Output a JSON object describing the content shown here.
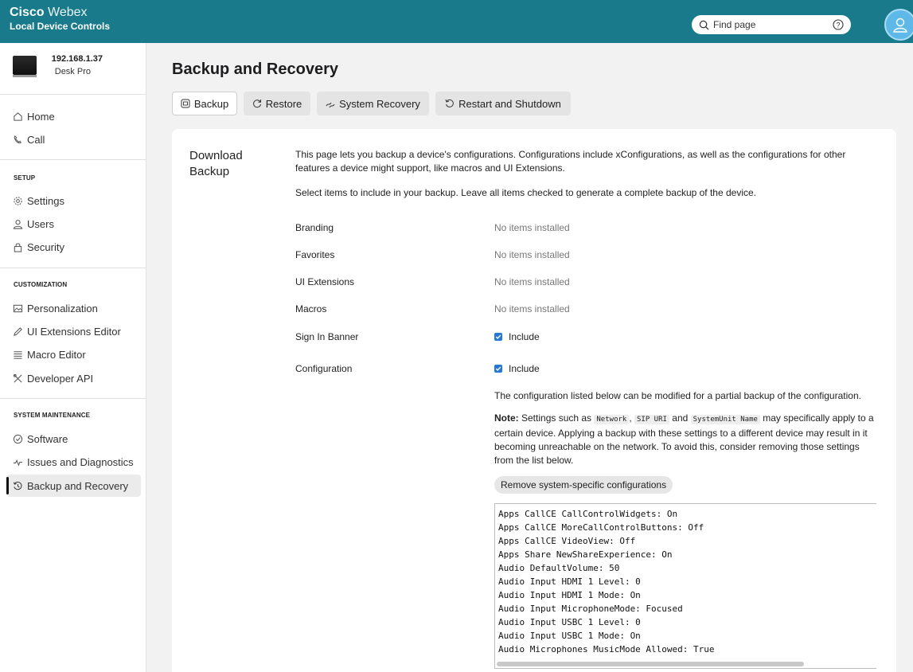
{
  "header": {
    "brand_cisco": "Cisco",
    "brand_webex": "Webex",
    "subtitle": "Local Device Controls",
    "search_placeholder": "Find page"
  },
  "sidebar": {
    "device_ip": "192.168.1.37",
    "device_model": "Desk Pro",
    "items_top": [
      {
        "label": "Home",
        "icon": "home-icon"
      },
      {
        "label": "Call",
        "icon": "phone-icon"
      }
    ],
    "setup_heading": "SETUP",
    "setup_items": [
      {
        "label": "Settings",
        "icon": "gear-icon"
      },
      {
        "label": "Users",
        "icon": "user-icon"
      },
      {
        "label": "Security",
        "icon": "lock-icon"
      }
    ],
    "customization_heading": "CUSTOMIZATION",
    "customization_items": [
      {
        "label": "Personalization",
        "icon": "image-icon"
      },
      {
        "label": "UI Extensions Editor",
        "icon": "pencil-icon"
      },
      {
        "label": "Macro Editor",
        "icon": "list-icon"
      },
      {
        "label": "Developer API",
        "icon": "tools-icon"
      }
    ],
    "maintenance_heading": "SYSTEM MAINTENANCE",
    "maintenance_items": [
      {
        "label": "Software",
        "icon": "software-icon"
      },
      {
        "label": "Issues and Diagnostics",
        "icon": "pulse-icon"
      },
      {
        "label": "Backup and Recovery",
        "icon": "history-icon",
        "active": true
      }
    ]
  },
  "page": {
    "title": "Backup and Recovery",
    "tabs": [
      {
        "label": "Backup",
        "icon": "backup-icon",
        "active": true
      },
      {
        "label": "Restore",
        "icon": "restore-icon"
      },
      {
        "label": "System Recovery",
        "icon": "recovery-icon"
      },
      {
        "label": "Restart and Shutdown",
        "icon": "restart-icon"
      }
    ]
  },
  "backup": {
    "section_title": "Download Backup",
    "intro": "This page lets you backup a device's configurations. Configurations include xConfigurations, as well as the configurations for other features a device might support, like macros and UI Extensions.",
    "instructions": "Select items to include in your backup. Leave all items checked to generate a complete backup of the device.",
    "items": [
      {
        "label": "Branding",
        "value": "No items installed"
      },
      {
        "label": "Favorites",
        "value": "No items installed"
      },
      {
        "label": "UI Extensions",
        "value": "No items installed"
      },
      {
        "label": "Macros",
        "value": "No items installed"
      }
    ],
    "sign_in_banner_label": "Sign In Banner",
    "sign_in_banner_checkbox": "Include",
    "configuration_label": "Configuration",
    "configuration_checkbox": "Include",
    "config_partial_text": "The configuration listed below can be modified for a partial backup of the configuration.",
    "note_label": "Note:",
    "note_text_1": " Settings such as ",
    "note_code_1": "Network",
    "note_text_2": ", ",
    "note_code_2": "SIP URI",
    "note_text_3": " and ",
    "note_code_3": "SystemUnit Name",
    "note_text_4": " may specifically apply to a certain device. Applying a backup with these settings to a different device may result in it becoming unreachable on the network. To avoid this, consider removing those settings from the list below.",
    "remove_button": "Remove system-specific configurations",
    "config_lines": [
      "Apps CallCE CallControlWidgets: On",
      "Apps CallCE MoreCallControlButtons: Off",
      "Apps CallCE VideoView: Off",
      "Apps Share NewShareExperience: On",
      "Audio DefaultVolume: 50",
      "Audio Input HDMI 1 Level: 0",
      "Audio Input HDMI 1 Mode: On",
      "Audio Input MicrophoneMode: Focused",
      "Audio Input USBC 1 Level: 0",
      "Audio Input USBC 1 Mode: On",
      "Audio Microphones MusicMode Allowed: True"
    ]
  },
  "colors": {
    "header_bg": "#187a8a",
    "avatar_bg": "#5fb9e8",
    "checkbox": "#2579d6"
  }
}
